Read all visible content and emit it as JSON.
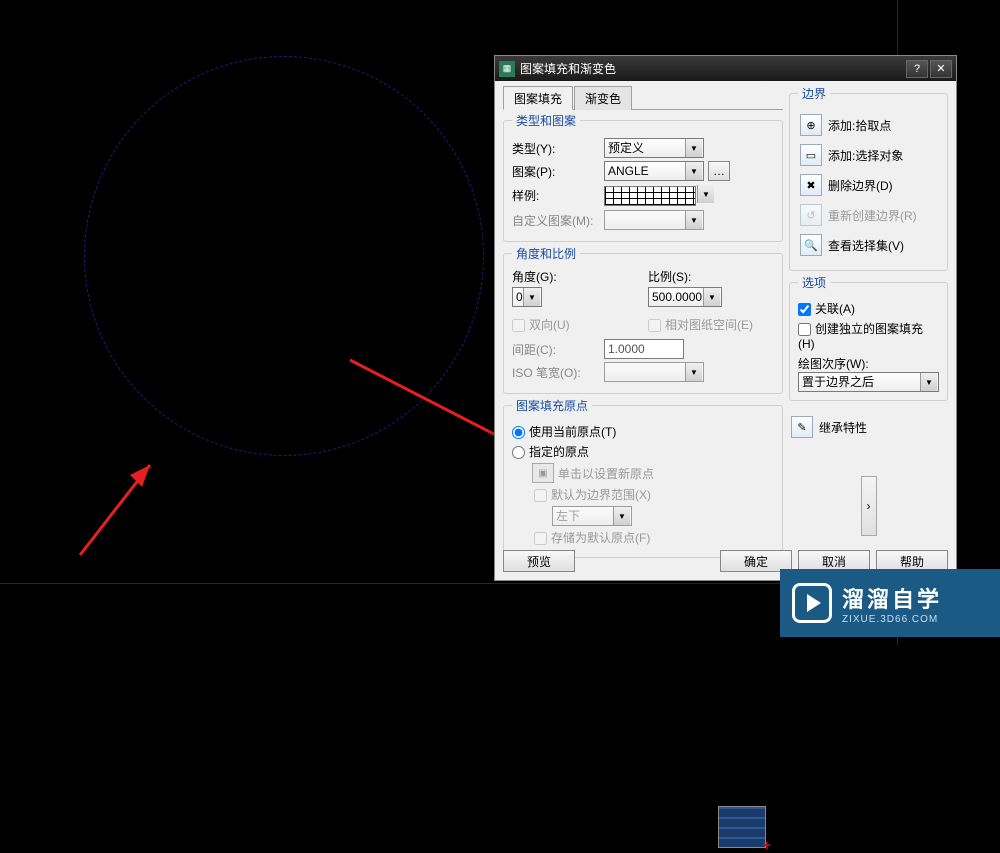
{
  "dialog": {
    "title": "图案填充和渐变色",
    "tabs": {
      "hatch": "图案填充",
      "gradient": "渐变色"
    },
    "type_pattern": {
      "legend": "类型和图案",
      "type_label": "类型(Y):",
      "type_value": "预定义",
      "pattern_label": "图案(P):",
      "pattern_value": "ANGLE",
      "sample_label": "样例:",
      "custom_label": "自定义图案(M):"
    },
    "angle_scale": {
      "legend": "角度和比例",
      "angle_label": "角度(G):",
      "angle_value": "0",
      "scale_label": "比例(S):",
      "scale_value": "500.0000",
      "double_label": "双向(U)",
      "relpaper_label": "相对图纸空间(E)",
      "spacing_label": "间距(C):",
      "spacing_value": "1.0000",
      "iso_label": "ISO 笔宽(O):"
    },
    "origin": {
      "legend": "图案填充原点",
      "use_current": "使用当前原点(T)",
      "specified": "指定的原点",
      "click_set": "单击以设置新原点",
      "default_extent": "默认为边界范围(X)",
      "extent_value": "左下",
      "store_default": "存储为默认原点(F)"
    },
    "boundary": {
      "legend": "边界",
      "add_pick": "添加:拾取点",
      "add_select": "添加:选择对象",
      "remove": "删除边界(D)",
      "recreate": "重新创建边界(R)",
      "view_sel": "查看选择集(V)"
    },
    "options": {
      "legend": "选项",
      "assoc": "关联(A)",
      "independent": "创建独立的图案填充(H)",
      "draw_order_label": "绘图次序(W):",
      "draw_order_value": "置于边界之后"
    },
    "inherit": "继承特性",
    "buttons": {
      "preview": "预览",
      "ok": "确定",
      "cancel": "取消",
      "help": "帮助"
    }
  },
  "watermark": {
    "name": "溜溜自学",
    "url": "ZIXUE.3D66.COM"
  }
}
